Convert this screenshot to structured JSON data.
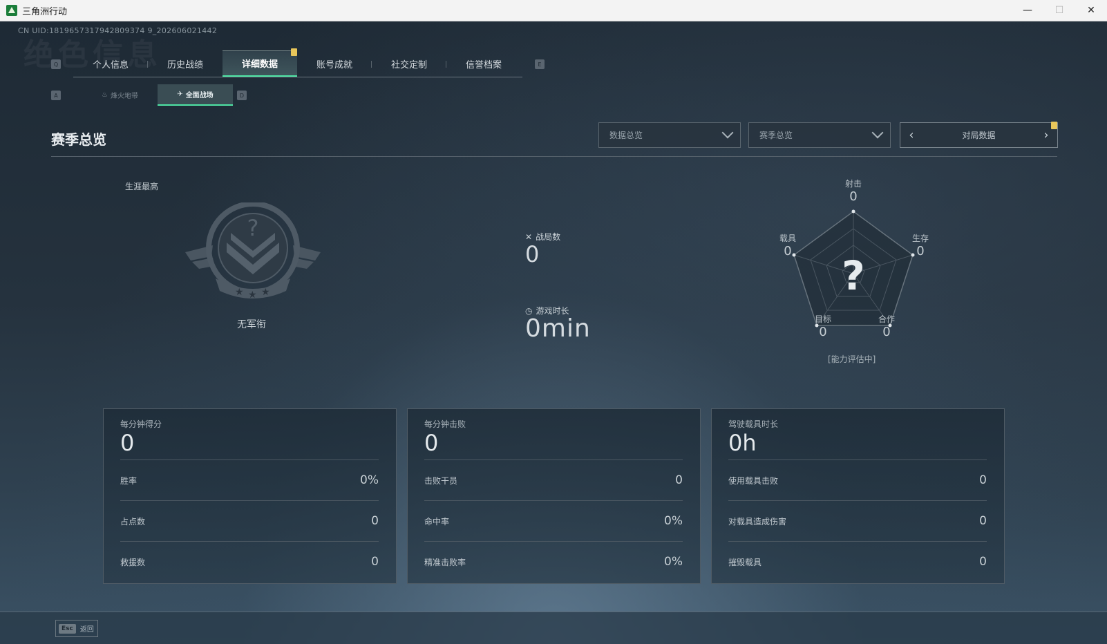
{
  "window": {
    "title": "三角洲行动",
    "controls": [
      "—",
      "☐",
      "✕"
    ]
  },
  "uid": "CN UID:1819657317942809374 9_202606021442",
  "watermark": "绝色信息",
  "main_tabs": {
    "prev_key": "Q",
    "next_key": "E",
    "items": [
      {
        "label": "个人信息"
      },
      {
        "label": "历史战绩"
      },
      {
        "label": "详细数据",
        "active": true,
        "badge": true
      },
      {
        "label": "账号成就"
      },
      {
        "label": "社交定制"
      },
      {
        "label": "信誉档案"
      }
    ]
  },
  "sub_tabs": {
    "prev_key": "A",
    "next_key": "D",
    "items": [
      {
        "label": "烽火地带"
      },
      {
        "label": "全面战场",
        "active": true
      }
    ]
  },
  "section": {
    "title": "赛季总览",
    "dropdown1": "数据总览",
    "dropdown2": "赛季总览",
    "pager_label": "对局数据"
  },
  "rank": {
    "career_label": "生涯最高",
    "name": "无军衔"
  },
  "center_stats": {
    "matches_label": "战局数",
    "matches_value": "0",
    "playtime_label": "游戏时长",
    "playtime_value": "0min"
  },
  "radar": {
    "axes": [
      {
        "label": "射击",
        "value": "0"
      },
      {
        "label": "生存",
        "value": "0"
      },
      {
        "label": "合作",
        "value": "0"
      },
      {
        "label": "目标",
        "value": "0"
      },
      {
        "label": "载具",
        "value": "0"
      }
    ],
    "status": "[能力评估中]"
  },
  "cards": [
    {
      "title": "每分钟得分",
      "big": "0",
      "rows": [
        {
          "label": "胜率",
          "value": "0%"
        },
        {
          "label": "占点数",
          "value": "0"
        },
        {
          "label": "救援数",
          "value": "0"
        }
      ]
    },
    {
      "title": "每分钟击败",
      "big": "0",
      "rows": [
        {
          "label": "击败干员",
          "value": "0"
        },
        {
          "label": "命中率",
          "value": "0%"
        },
        {
          "label": "精准击败率",
          "value": "0%"
        }
      ]
    },
    {
      "title": "驾驶载具时长",
      "big": "0h",
      "rows": [
        {
          "label": "使用载具击败",
          "value": "0"
        },
        {
          "label": "对载具造成伤害",
          "value": "0"
        },
        {
          "label": "摧毁载具",
          "value": "0"
        }
      ]
    }
  ],
  "bottom": {
    "esc_key": "Esc",
    "esc_label": "返回"
  },
  "colors": {
    "accent": "#4fe6a6",
    "badge": "#e8c65a"
  }
}
